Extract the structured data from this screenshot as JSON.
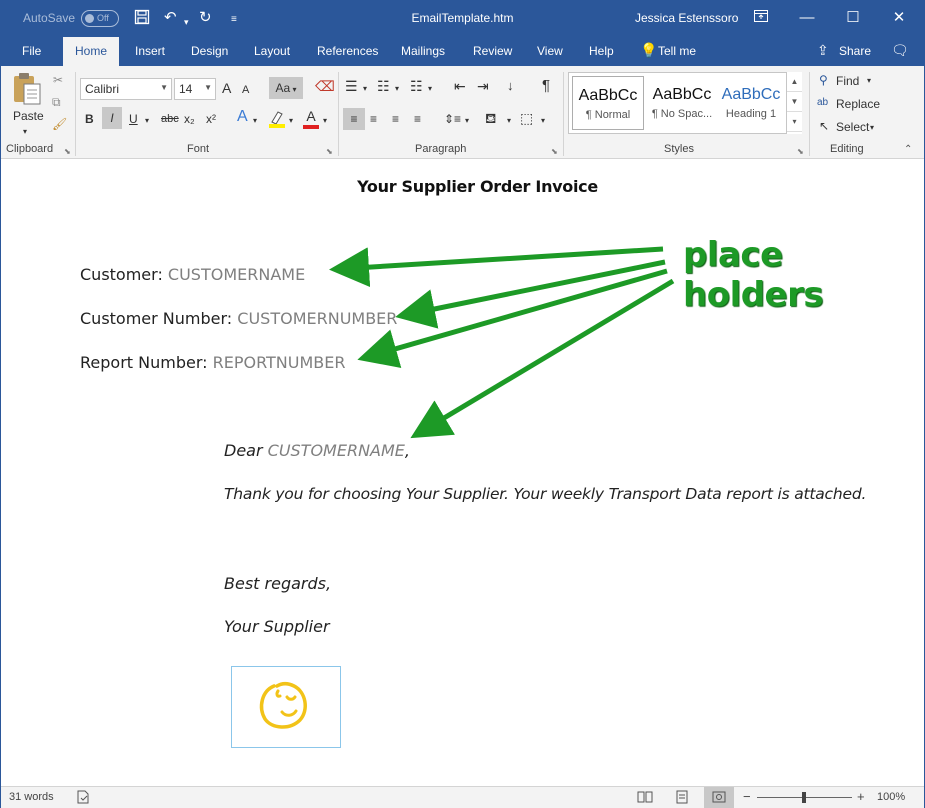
{
  "titlebar": {
    "autosave_label": "AutoSave",
    "autosave_state": "Off",
    "document_title": "EmailTemplate.htm",
    "user_name": "Jessica Estenssoro"
  },
  "tabs": [
    "File",
    "Home",
    "Insert",
    "Design",
    "Layout",
    "References",
    "Mailings",
    "Review",
    "View",
    "Help",
    "Tell me"
  ],
  "share_label": "Share",
  "ribbon": {
    "clipboard": {
      "paste_label": "Paste",
      "group_label": "Clipboard"
    },
    "font": {
      "font_name": "Calibri",
      "font_size": "14",
      "group_label": "Font",
      "bold": "B",
      "italic": "I",
      "underline": "U",
      "strike": "abc",
      "subscript": "x₂",
      "superscript": "x²",
      "grow": "A",
      "shrink": "A",
      "case": "Aa"
    },
    "paragraph": {
      "group_label": "Paragraph"
    },
    "styles": {
      "group_label": "Styles",
      "items": [
        {
          "preview": "AaBbCc",
          "name": "¶ Normal"
        },
        {
          "preview": "AaBbCc",
          "name": "¶ No Spac..."
        },
        {
          "preview": "AaBbCc",
          "name": "Heading 1"
        }
      ]
    },
    "editing": {
      "group_label": "Editing",
      "find": "Find",
      "replace": "Replace",
      "select": "Select"
    }
  },
  "document": {
    "heading": "Your Supplier Order Invoice",
    "fields": [
      {
        "label": "Customer: ",
        "placeholder": "CUSTOMERNAME"
      },
      {
        "label": "Customer Number: ",
        "placeholder": "CUSTOMERNUMBER"
      },
      {
        "label": "Report Number: ",
        "placeholder": "REPORTNUMBER"
      }
    ],
    "greeting_prefix": "Dear ",
    "greeting_placeholder": "CUSTOMERNAME",
    "greeting_suffix": ",",
    "body": "Thank you for choosing Your Supplier. Your weekly Transport Data report is attached.",
    "closing": "Best regards,",
    "signature": "Your Supplier",
    "annotation": "place holders"
  },
  "statusbar": {
    "word_count": "31 words",
    "zoom": "100%"
  },
  "colors": {
    "brand": "#2b579a",
    "annotation_green": "#1d9a26",
    "placeholder_gray": "#7f7f7f",
    "logo_yellow": "#f2c318"
  }
}
